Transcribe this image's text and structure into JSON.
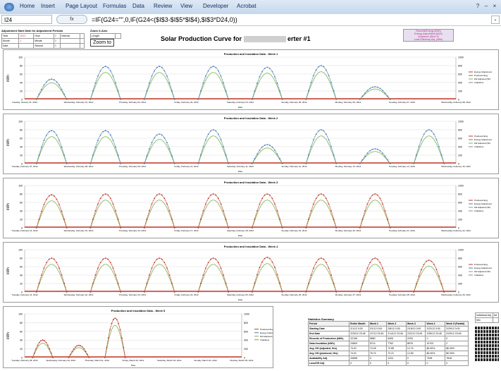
{
  "ribbon": {
    "tabs": [
      "Home",
      "Insert",
      "Page Layout",
      "Formulas",
      "Data",
      "Review",
      "View",
      "Developer",
      "Acrobat"
    ]
  },
  "formula_bar": {
    "name_box": "I24",
    "fx_label": "fx",
    "formula": "=IF(G24=\"\",0,IF(G24<($I$3-$I$5*$I$4),$I$3*D24,0))"
  },
  "panels": {
    "adjust_title": "Adjustment Start Date for Adjustment Periods",
    "adjust_rows": [
      [
        "Year",
        "2012",
        "Hour",
        "0",
        "Interval",
        ""
      ],
      [
        "Month",
        "1",
        "Minute",
        "0",
        "",
        ""
      ],
      [
        "Date",
        "",
        "Second",
        "0",
        "",
        ""
      ]
    ],
    "zoom_title": "Zoom X-Axis",
    "zoom_rows": [
      [
        "Length",
        ""
      ],
      [
        "Zoom to",
        ""
      ]
    ],
    "zoom_button": "Zoom to",
    "legend_box": [
      "Records/Energy (kWh)",
      "Energy Adjustment (kWh)",
      "Irradiance (W/m^2)",
      "Load Efficiency Adj. (kWh)"
    ]
  },
  "page_title": "Solar Production Curve for",
  "page_title_suffix": "erter #1",
  "charts": [
    {
      "title": "Production and Insolation Data - Week 1",
      "ylabel": "kWh",
      "xlabel": "Date",
      "xticks": [
        "Tuesday, January 31, 2012",
        "Wednesday, February 01, 2012",
        "Thursday, February 02, 2012",
        "Friday, February 03, 2012",
        "Saturday, February 04, 2012",
        "Sunday, February 05, 2012",
        "Monday, February 06, 2012",
        "Tuesday, February 07, 2012",
        "Wednesday, February 08, 2012"
      ]
    },
    {
      "title": "Production and Insolation Data - Week 2",
      "ylabel": "kWh",
      "xlabel": "Date",
      "xticks": [
        "Tuesday, February 07, 2012",
        "Wednesday, February 08, 2012",
        "Thursday, February 09, 2012",
        "Friday, February 10, 2012",
        "Saturday, February 11, 2012",
        "Sunday, February 12, 2012",
        "Monday, February 13, 2012",
        "Tuesday, February 14, 2012",
        "Wednesday, February 15, 2012"
      ]
    },
    {
      "title": "Production and Insolation Data - Week 3",
      "ylabel": "kWh",
      "xlabel": "Date",
      "xticks": [
        "Tuesday, February 14, 2012",
        "Wednesday, February 15, 2012",
        "Thursday, February 16, 2012",
        "Friday, February 17, 2012",
        "Saturday, February 18, 2012",
        "Sunday, February 19, 2012",
        "Monday, February 20, 2012",
        "Tuesday, February 21, 2012",
        "Wednesday, February 22, 2012"
      ]
    },
    {
      "title": "Production and Insolation Data - Week 4",
      "ylabel": "kWh",
      "xlabel": "Date",
      "xticks": [
        "Tuesday, February 21, 2012",
        "Wednesday, February 22, 2012",
        "Thursday, February 23, 2012",
        "Friday, February 24, 2012",
        "Saturday, February 25, 2012",
        "Sunday, February 26, 2012",
        "Monday, February 27, 2012",
        "Tuesday, February 28, 2012",
        "Wednesday, February 29, 2012"
      ]
    },
    {
      "title": "Production and Insolation Data - Week 5",
      "ylabel": "kWh",
      "xlabel": "Date",
      "xticks": [
        "Tuesday, February 28, 2012",
        "Wednesday, February 29, 2012",
        "Thursday, March 01, 2012",
        "Friday, March 02, 2012",
        "Saturday, March 03, 2012",
        "Sunday, March 04, 2012",
        "Monday, March 05, 2012"
      ]
    }
  ],
  "chart_data": [
    {
      "type": "line",
      "title": "Production and Insolation Data - Week 1",
      "ylim": [
        0,
        100
      ],
      "y2lim": [
        0,
        1000
      ],
      "peaks": [
        48,
        78,
        78,
        78,
        76,
        80,
        30
      ],
      "series": [
        {
          "name": "Energy Adjustment"
        },
        {
          "name": "Produced Eng"
        },
        {
          "name": "kW Adjusted (SF)"
        },
        {
          "name": "Irradiance"
        }
      ]
    },
    {
      "type": "line",
      "title": "Production and Insolation Data - Week 2",
      "ylim": [
        0,
        100
      ],
      "y2lim": [
        0,
        1000
      ],
      "peaks": [
        78,
        78,
        70,
        80,
        45,
        80,
        35,
        80
      ],
      "series": [
        {
          "name": "Produced Eng"
        },
        {
          "name": "Energy Adjustment"
        },
        {
          "name": "kW Adjusted (SF)"
        },
        {
          "name": "Irradiance"
        }
      ]
    },
    {
      "type": "line",
      "title": "Production and Insolation Data - Week 3",
      "ylim": [
        0,
        100
      ],
      "y2lim": [
        0,
        1000
      ],
      "peaks": [
        78,
        80,
        80,
        80,
        80,
        80,
        80
      ],
      "series": [
        {
          "name": "Produced Eng"
        },
        {
          "name": "Energy Adjustment"
        },
        {
          "name": "kW Adjusted (SF)"
        },
        {
          "name": "Irradiance"
        }
      ]
    },
    {
      "type": "line",
      "title": "Production and Insolation Data - Week 4",
      "ylim": [
        0,
        100
      ],
      "y2lim": [
        0,
        1000
      ],
      "peaks": [
        80,
        80,
        80,
        80,
        82,
        80,
        80,
        75
      ],
      "series": [
        {
          "name": "Produced Eng"
        },
        {
          "name": "Energy Adjustment"
        },
        {
          "name": "kW Adjusted (SF)"
        },
        {
          "name": "Irradiance"
        }
      ]
    },
    {
      "type": "line",
      "title": "Production and Insolation Data - Week 5",
      "ylim": [
        0,
        100
      ],
      "y2lim": [
        0,
        1000
      ],
      "peaks": [
        40,
        28,
        90
      ],
      "series": [
        {
          "name": "Produced Eng"
        },
        {
          "name": "Energy Adjustment"
        },
        {
          "name": "kW Adjusted (SF)"
        },
        {
          "name": "Irradiance"
        }
      ]
    }
  ],
  "stats": {
    "title": "Statistics Summary",
    "header": [
      "Period",
      "Entire Month",
      "Week 1",
      "Week 2",
      "Week 3",
      "Week 4",
      "Week 5 (Partial)"
    ],
    "rows": [
      [
        "Starting Date",
        "2/1/12 0:00",
        "2/1/12 0:00",
        "2/8/12 0:00",
        "2/15/12 0:00",
        "2/22/12 0:00",
        "2/29/12 0:00"
      ],
      [
        "End Date",
        "2/29/12 23:45",
        "2/7/12 23:45",
        "2/14/12 23:45",
        "2/21/12 23:45",
        "2/28/12 23:45",
        "2/29/12 23:45"
      ],
      [
        "Records of Production (kWh)",
        "22196",
        "5860",
        "5406",
        "2226",
        "0",
        "0"
      ],
      [
        "Data Insolation (kWh)",
        "24809",
        "5714",
        "7762",
        "8578",
        "10702",
        "2"
      ],
      [
        "Avg. DH (adjusted, Hrs)",
        "74.91",
        "74.26",
        "72.85",
        "12.74",
        "$0.00%",
        "$0.00%"
      ],
      [
        "Avg. DH (produced, Hrs)",
        "74.91",
        "75.74",
        "72.21",
        "12.69",
        "$0.00%",
        "$0.00%"
      ],
      [
        "Availability Adj.",
        "24698",
        "0",
        "1224",
        "0",
        "7328",
        "7818"
      ],
      [
        "Loss/GH Adj.",
        "0",
        "0",
        "0",
        "0",
        "0",
        "0"
      ]
    ],
    "side_header": [
      "Individual Adj.",
      "Ad.",
      "Min"
    ]
  },
  "colors": {
    "production": "#4a7fb0",
    "adjustment": "#c0392b",
    "irradiance": "#7fb34a",
    "excel_blue": "#15315c"
  }
}
